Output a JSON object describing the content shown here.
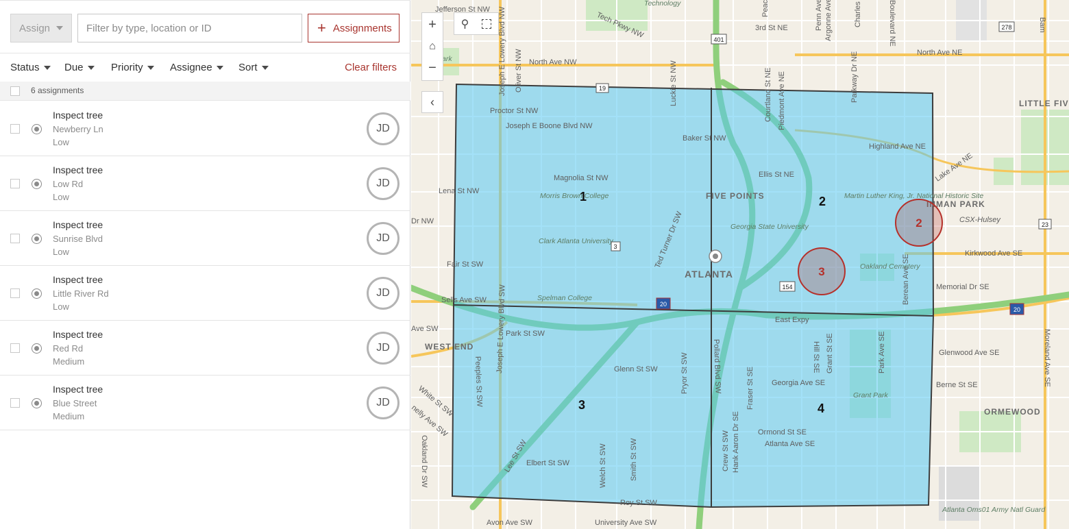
{
  "toolbar": {
    "assign_label": "Assign",
    "filter_placeholder": "Filter by type, location or ID",
    "assignments_label": "Assignments"
  },
  "filters": {
    "status": "Status",
    "due": "Due",
    "priority": "Priority",
    "assignee": "Assignee",
    "sort": "Sort",
    "clear": "Clear filters"
  },
  "list": {
    "count_text": "6 assignments",
    "items": [
      {
        "title": "Inspect tree",
        "location": "Newberry Ln",
        "priority": "Low",
        "assignee": "JD"
      },
      {
        "title": "Inspect tree",
        "location": "Low Rd",
        "priority": "Low",
        "assignee": "JD"
      },
      {
        "title": "Inspect tree",
        "location": "Sunrise Blvd",
        "priority": "Low",
        "assignee": "JD"
      },
      {
        "title": "Inspect tree",
        "location": "Little River Rd",
        "priority": "Low",
        "assignee": "JD"
      },
      {
        "title": "Inspect tree",
        "location": "Red Rd",
        "priority": "Medium",
        "assignee": "JD"
      },
      {
        "title": "Inspect tree",
        "location": "Blue Street",
        "priority": "Medium",
        "assignee": "JD"
      }
    ]
  },
  "map": {
    "zones": [
      "1",
      "2",
      "3",
      "4"
    ],
    "clusters": [
      "2",
      "3"
    ],
    "neighborhoods": [
      "FIVE POINTS",
      "ATLANTA",
      "WEST END",
      "INMAN PARK",
      "LITTLE FIVE POINTS",
      "ORMEWOOD"
    ],
    "streets": [
      "Jefferson St NW",
      "Tech Pkwy NW",
      "North Ave NW",
      "North Ave NE",
      "3rd St NE",
      "Proctor St NW",
      "Joseph E Boone Blvd NW",
      "Baker St NW",
      "Highland Ave NE",
      "Magnolia St NW",
      "Ellis St NE",
      "Lena St NW",
      "Fair St SW",
      "Sells Ave SW",
      "Park St SW",
      "East Expy",
      "Glenn St SW",
      "Georgia Ave SE",
      "Ormond St SE",
      "Atlanta Ave SE",
      "Elbert St SW",
      "Roy St SW",
      "University Ave SW",
      "Avon Ave SW",
      "Kirkwood Ave SE",
      "Memorial Dr SE",
      "Glenwood Ave SE",
      "Berne St SE",
      "CSX-Hulsey",
      "Lake Ave NE",
      "Ted Turner Dr SW",
      "Pollard Blvd SW",
      "Lee St SW",
      "White St SW",
      "Oakland Dr SW",
      "Peeples St SW",
      "Joseph E Lowery Blvd SW",
      "Pryor St SW",
      "Hill St SE",
      "Grant St SE",
      "Park Ave SE",
      "Boulevard NE",
      "Courtland St NE",
      "Piedmont Ave NE",
      "Moreland Ave SE",
      "Luckie St NW",
      "Dr NW",
      "Welch St SW",
      "Smith St SW",
      "Crew St SW",
      "Hank Aaron Dr SE",
      "Fraser St SE",
      "Berean Ave SE",
      "Parkway Dr NE",
      "Penn Ave NE",
      "Argonne Ave NE",
      "Peachtree St NE",
      "Charles St NE",
      "Bam",
      "Oliver St NW",
      "Joseph E Lowery Blvd NW",
      "Ave SW",
      "nelly Ave SW"
    ],
    "pois": [
      "Morris Brown College",
      "Clark Atlanta University",
      "Georgia State University",
      "Martin Luther King, Jr. National Historic Site",
      "Oakland Cemetery",
      "Spelman College",
      "Grant Park",
      "Atlanta Oms01 Army Natl Guard",
      "Technology",
      "Park"
    ],
    "shields": [
      "401",
      "278",
      "19",
      "3",
      "154",
      "20",
      "23"
    ],
    "colors": {
      "zone_fill": "#57c8f2",
      "cluster": "#b5302a",
      "accent": "#a8342e"
    }
  }
}
